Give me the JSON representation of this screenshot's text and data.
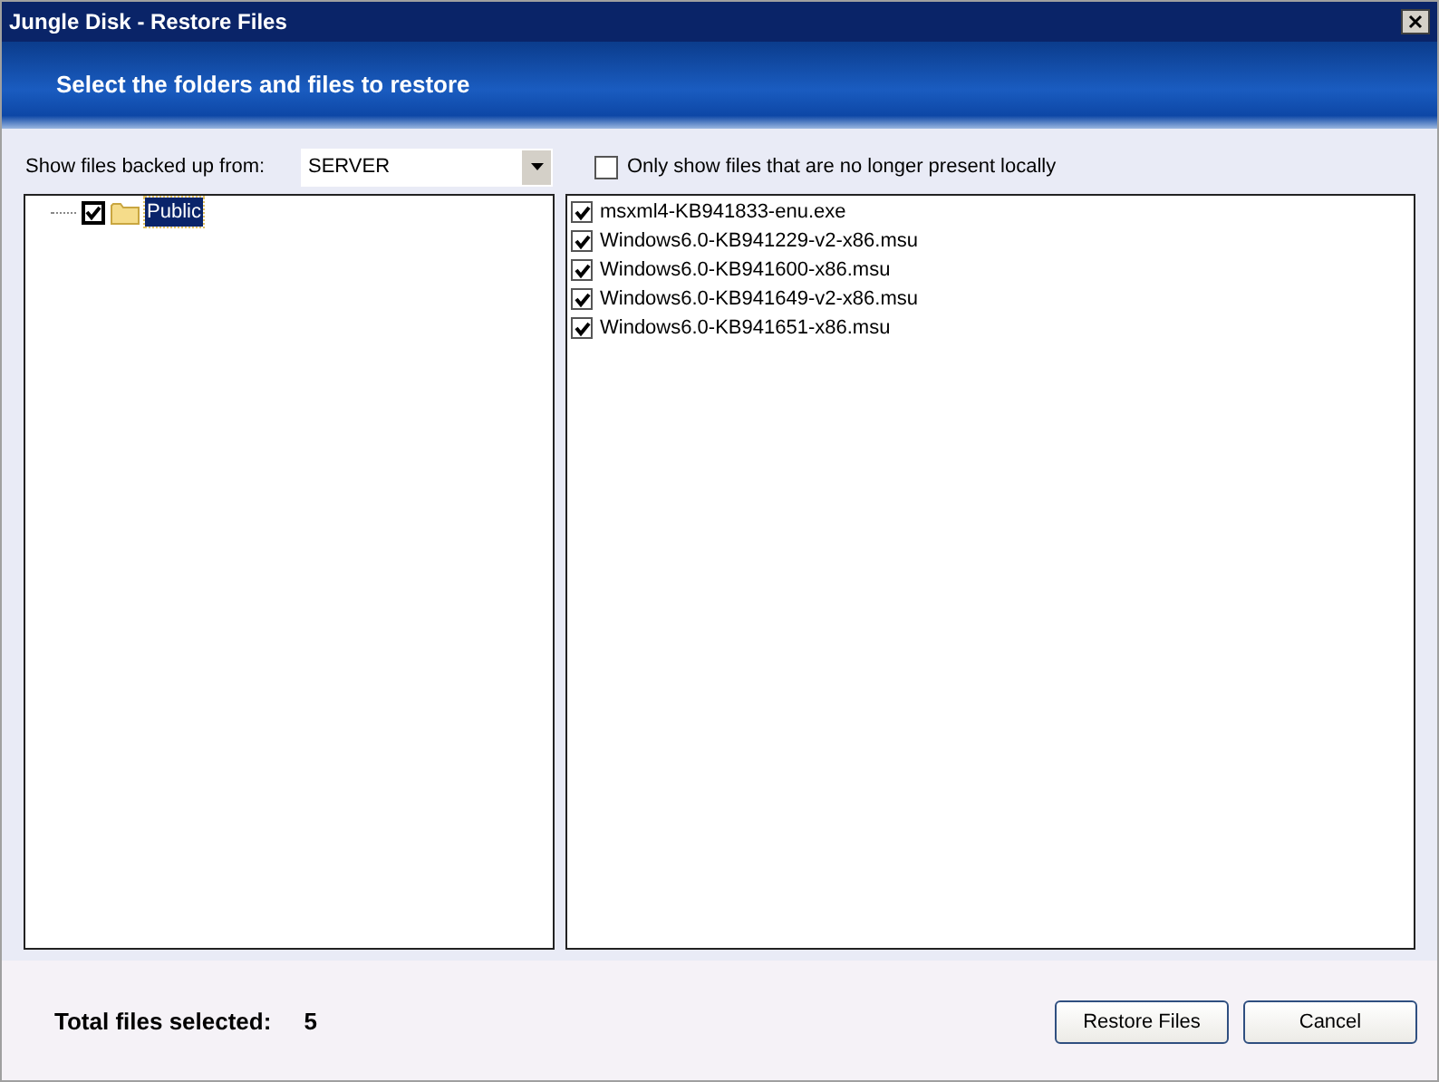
{
  "window": {
    "title": "Jungle Disk - Restore Files"
  },
  "banner": {
    "heading": "Select the folders and files to restore"
  },
  "source": {
    "label": "Show files backed up from:",
    "value": "SERVER"
  },
  "filter": {
    "label": "Only show files that are no longer present locally",
    "checked": false
  },
  "tree": [
    {
      "label": "Public",
      "checked": true,
      "selected": true
    }
  ],
  "files": [
    {
      "name": "msxml4-KB941833-enu.exe",
      "checked": true
    },
    {
      "name": "Windows6.0-KB941229-v2-x86.msu",
      "checked": true
    },
    {
      "name": "Windows6.0-KB941600-x86.msu",
      "checked": true
    },
    {
      "name": "Windows6.0-KB941649-v2-x86.msu",
      "checked": true
    },
    {
      "name": "Windows6.0-KB941651-x86.msu",
      "checked": true
    }
  ],
  "footer": {
    "total_label": "Total files selected:",
    "total_value": "5"
  },
  "buttons": [
    "Restore Files",
    "Cancel"
  ]
}
